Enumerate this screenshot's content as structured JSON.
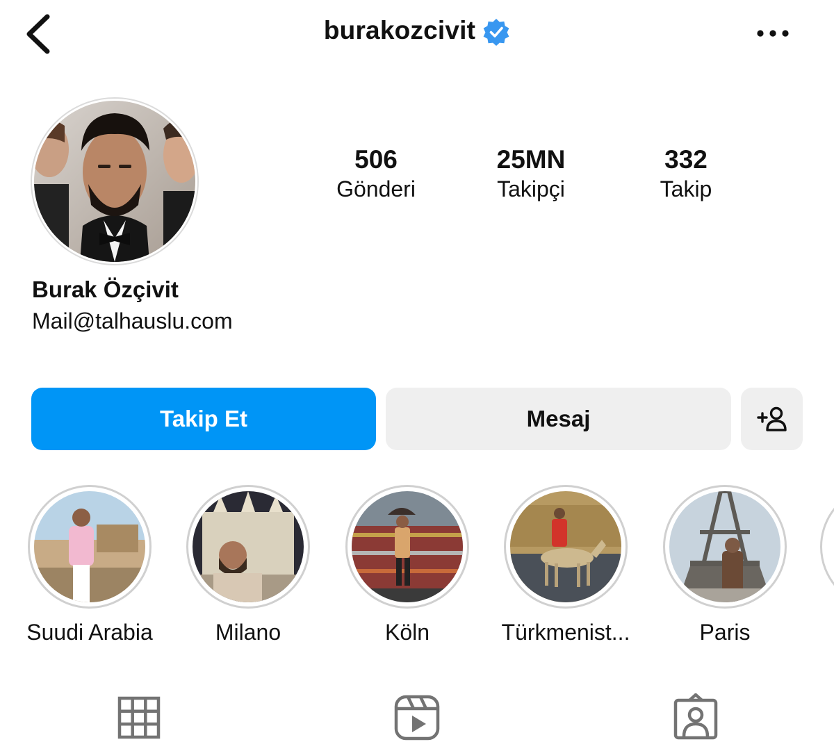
{
  "header": {
    "username": "burakozcivit",
    "back_icon": "chevron-left-icon",
    "verified_icon": "verified-badge-icon",
    "more_icon": "more-horizontal-icon"
  },
  "profile": {
    "full_name": "Burak Özçivit",
    "bio": "Mail@talhauslu.com",
    "stats": [
      {
        "value": "506",
        "label": "Gönderi"
      },
      {
        "value": "25MN",
        "label": "Takipçi"
      },
      {
        "value": "332",
        "label": "Takip"
      }
    ]
  },
  "actions": {
    "follow_label": "Takip Et",
    "message_label": "Mesaj",
    "suggest_icon": "add-person-icon"
  },
  "highlights": [
    {
      "label": "Suudi Arabia"
    },
    {
      "label": "Milano"
    },
    {
      "label": "Köln"
    },
    {
      "label": "Türkmenist..."
    },
    {
      "label": "Paris"
    }
  ],
  "tabs": [
    {
      "icon": "grid-icon"
    },
    {
      "icon": "reels-icon"
    },
    {
      "icon": "tagged-icon"
    }
  ],
  "colors": {
    "accent": "#0095f6",
    "verified": "#3897f0",
    "button_secondary": "#efefef",
    "icon_gray": "#737373"
  }
}
